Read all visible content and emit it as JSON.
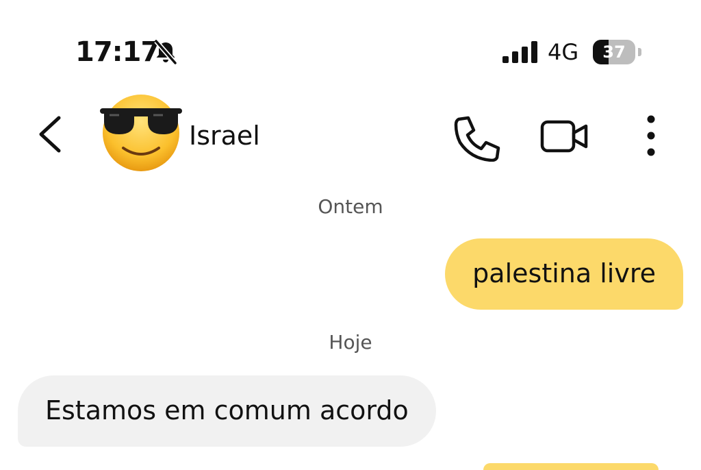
{
  "status_bar": {
    "time": "17:17",
    "network": "4G",
    "battery_percent": 37,
    "battery_label": "37",
    "mute_icon": "bell-slash-icon",
    "signal_icon": "signal-bars-icon"
  },
  "header": {
    "contact_name": "Israel",
    "avatar_emoji": "😎",
    "back_icon": "chevron-left-icon",
    "call_icon": "phone-icon",
    "video_icon": "video-camera-icon",
    "more_icon": "vertical-ellipsis-icon"
  },
  "conversation": {
    "day_1": "Ontem",
    "message_out_1": "palestina livre",
    "day_2": "Hoje",
    "message_in_1": "Estamos em comum acordo"
  },
  "colors": {
    "outgoing_bubble": "#fcd96a",
    "incoming_bubble": "#f1f1f1",
    "background": "#ffffff",
    "text": "#111111",
    "secondary_text": "#555555"
  }
}
